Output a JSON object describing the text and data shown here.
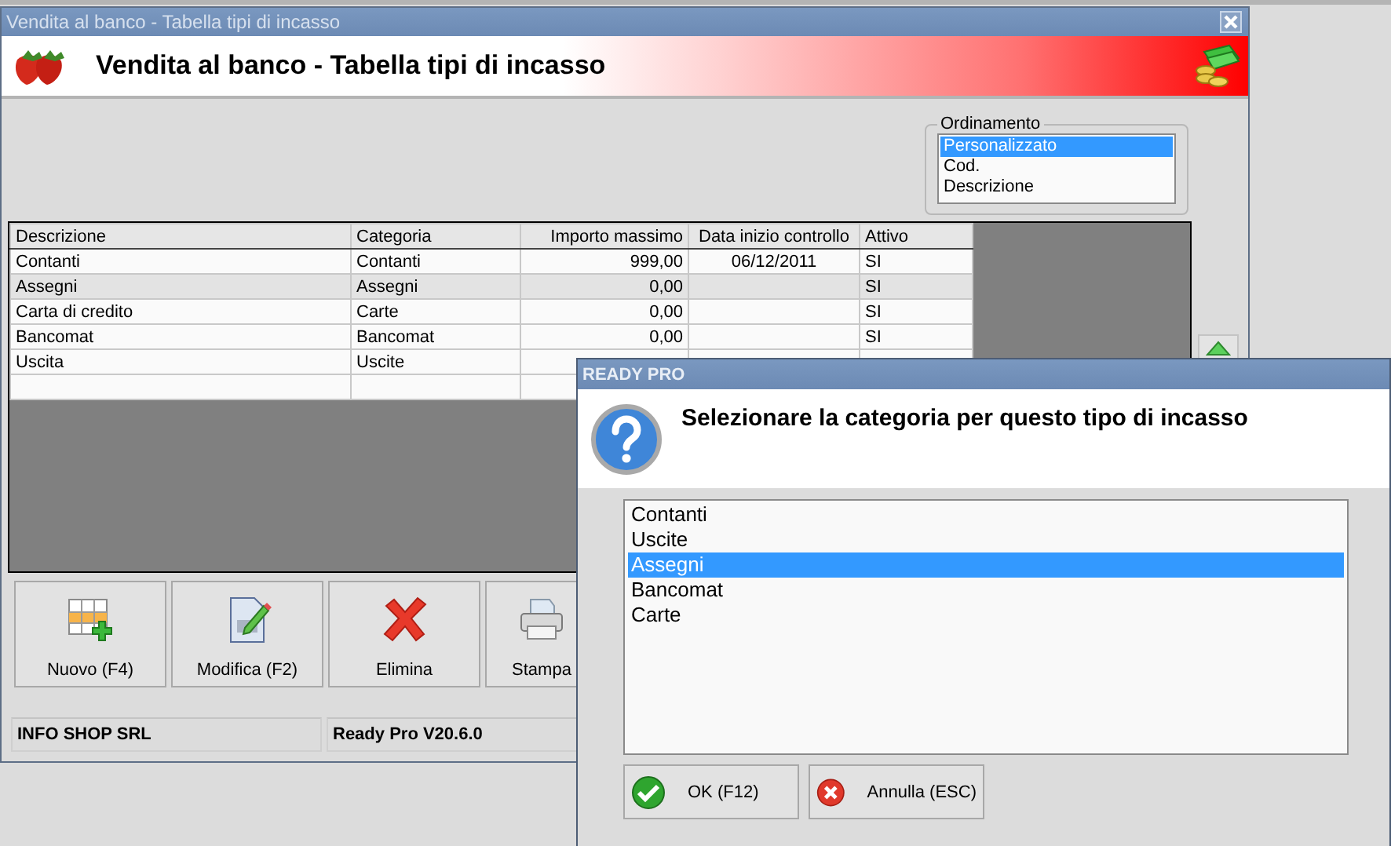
{
  "main_window": {
    "title": "Vendita al banco - Tabella tipi di incasso",
    "header": "Vendita al banco - Tabella tipi di incasso",
    "sort_group": {
      "label": "Ordinamento",
      "options": [
        {
          "label": "Personalizzato",
          "selected": true
        },
        {
          "label": "Cod.",
          "selected": false
        },
        {
          "label": "Descrizione",
          "selected": false
        }
      ]
    },
    "table": {
      "columns": [
        "Descrizione",
        "Categoria",
        "Importo massimo",
        "Data inizio controllo",
        "Attivo"
      ],
      "rows": [
        {
          "cells": [
            "Contanti",
            "Contanti",
            "999,00",
            "06/12/2011",
            "SI"
          ],
          "selected": false
        },
        {
          "cells": [
            "Assegni",
            "Assegni",
            "0,00",
            "",
            "SI"
          ],
          "selected": true
        },
        {
          "cells": [
            "Carta di credito",
            "Carte",
            "0,00",
            "",
            "SI"
          ],
          "selected": false
        },
        {
          "cells": [
            "Bancomat",
            "Bancomat",
            "0,00",
            "",
            "SI"
          ],
          "selected": false
        },
        {
          "cells": [
            "Uscita",
            "Uscite"
          ],
          "selected": false
        }
      ]
    },
    "buttons": [
      {
        "label": "Nuovo (F4)",
        "kind": "new"
      },
      {
        "label": "Modifica (F2)",
        "kind": "edit"
      },
      {
        "label": "Elimina",
        "kind": "delete"
      },
      {
        "label": "Stampa",
        "kind": "print"
      }
    ],
    "status_bar": [
      "INFO SHOP SRL",
      "Ready Pro V20.6.0"
    ]
  },
  "dialog": {
    "title": "READY PRO",
    "message": "Selezionare la categoria per questo tipo di incasso",
    "options": [
      {
        "label": "Contanti",
        "selected": false
      },
      {
        "label": "Uscite",
        "selected": false
      },
      {
        "label": "Assegni",
        "selected": true
      },
      {
        "label": "Bancomat",
        "selected": false
      },
      {
        "label": "Carte",
        "selected": false
      }
    ],
    "buttons": [
      {
        "label": "OK (F12)",
        "kind": "ok"
      },
      {
        "label": "Annulla (ESC)",
        "kind": "cancel"
      }
    ]
  }
}
